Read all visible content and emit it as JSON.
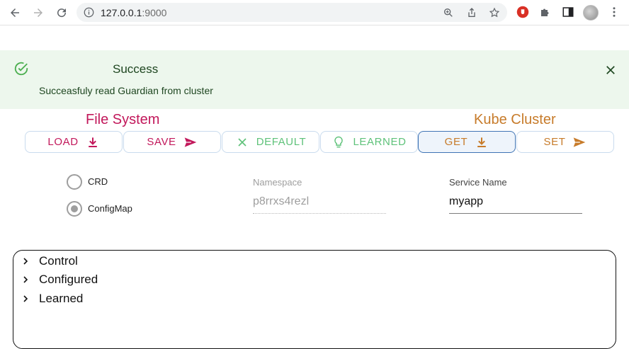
{
  "browser": {
    "url_host": "127.0.0.1",
    "url_port": ":9000"
  },
  "alert": {
    "title": "Success",
    "message": "Succeasfuly read Guardian from cluster"
  },
  "groups": {
    "file_system": "File System",
    "kube_cluster": "Kube Cluster"
  },
  "buttons": {
    "load": "LOAD",
    "save": "SAVE",
    "default": "DEFAULT",
    "learned": "LEARNED",
    "get": "GET",
    "set": "SET"
  },
  "radios": {
    "crd": "CRD",
    "configmap": "ConfigMap",
    "selected": "ConfigMap"
  },
  "fields": {
    "namespace_label": "Namespace",
    "namespace_value": "p8rrxs4rezl",
    "service_label": "Service Name",
    "service_value": "myapp"
  },
  "tree": {
    "items": [
      "Control",
      "Configured",
      "Learned"
    ]
  },
  "colors": {
    "pink": "#c2185b",
    "green": "#5fc27a",
    "orange": "#c77b2a",
    "success_bg": "#edf7ed"
  }
}
